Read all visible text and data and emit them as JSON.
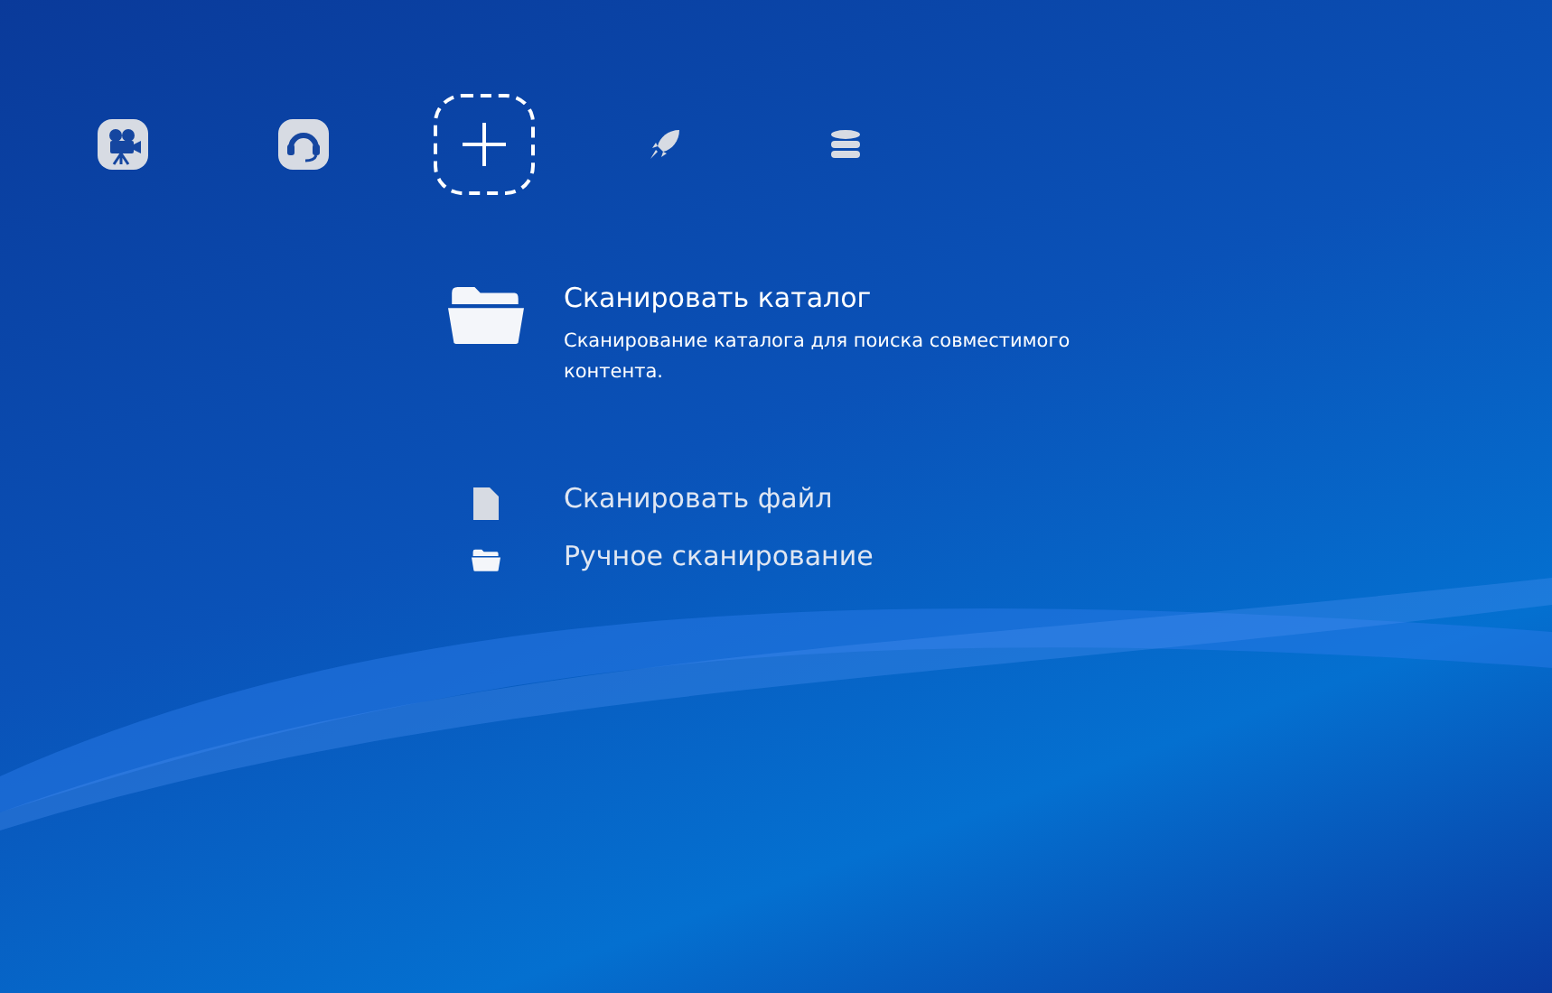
{
  "categories": [
    {
      "kind": "video",
      "selected": false
    },
    {
      "kind": "headset",
      "selected": false
    },
    {
      "kind": "add",
      "selected": true
    },
    {
      "kind": "rocket",
      "selected": false
    },
    {
      "kind": "database",
      "selected": false
    }
  ],
  "items": [
    {
      "kind": "folder",
      "label": "Сканировать каталог",
      "description": "Сканирование каталога для поиска совместимого контента.",
      "selected": true
    },
    {
      "kind": "file",
      "label": "Сканировать файл",
      "selected": false
    },
    {
      "kind": "folder",
      "label": "Ручное сканирование",
      "selected": false
    }
  ]
}
